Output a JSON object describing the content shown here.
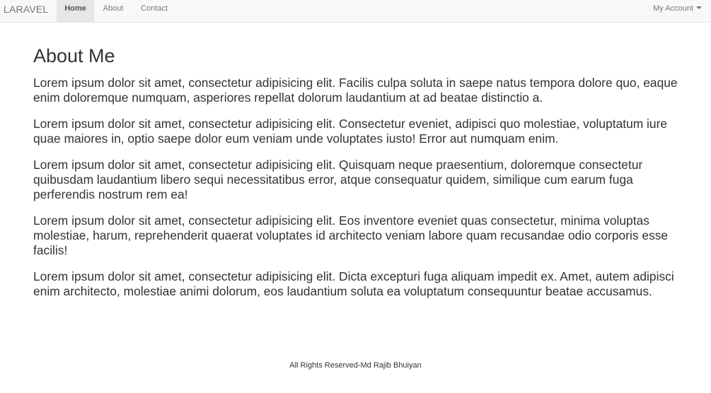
{
  "navbar": {
    "brand": "LARAVEL",
    "links": [
      {
        "label": "Home",
        "active": true
      },
      {
        "label": "About",
        "active": false
      },
      {
        "label": "Contact",
        "active": false
      }
    ],
    "account_label": "My Account"
  },
  "page": {
    "title": "About Me",
    "paragraphs": [
      "Lorem ipsum dolor sit amet, consectetur adipisicing elit. Facilis culpa soluta in saepe natus tempora dolore quo, eaque enim doloremque numquam, asperiores repellat dolorum laudantium at ad beatae distinctio a.",
      "Lorem ipsum dolor sit amet, consectetur adipisicing elit. Consectetur eveniet, adipisci quo molestiae, voluptatum iure quae maiores in, optio saepe dolor eum veniam unde voluptates iusto! Error aut numquam enim.",
      "Lorem ipsum dolor sit amet, consectetur adipisicing elit. Quisquam neque praesentium, doloremque consectetur quibusdam laudantium libero sequi necessitatibus error, atque consequatur quidem, similique cum earum fuga perferendis nostrum rem ea!",
      "Lorem ipsum dolor sit amet, consectetur adipisicing elit. Eos inventore eveniet quas consectetur, minima voluptas molestiae, harum, reprehenderit quaerat voluptates id architecto veniam labore quam recusandae odio corporis esse facilis!",
      "Lorem ipsum dolor sit amet, consectetur adipisicing elit. Dicta excepturi fuga aliquam impedit ex. Amet, autem adipisci enim architecto, molestiae animi dolorum, eos laudantium soluta ea voluptatum consequuntur beatae accusamus."
    ]
  },
  "footer": {
    "text": "All Rights Reserved-Md Rajib Bhuiyan"
  },
  "colors": {
    "navbar_bg": "#f8f8f8",
    "active_tab_bg": "#e7e7e7",
    "nav_text": "#777777",
    "body_text": "#333333"
  }
}
